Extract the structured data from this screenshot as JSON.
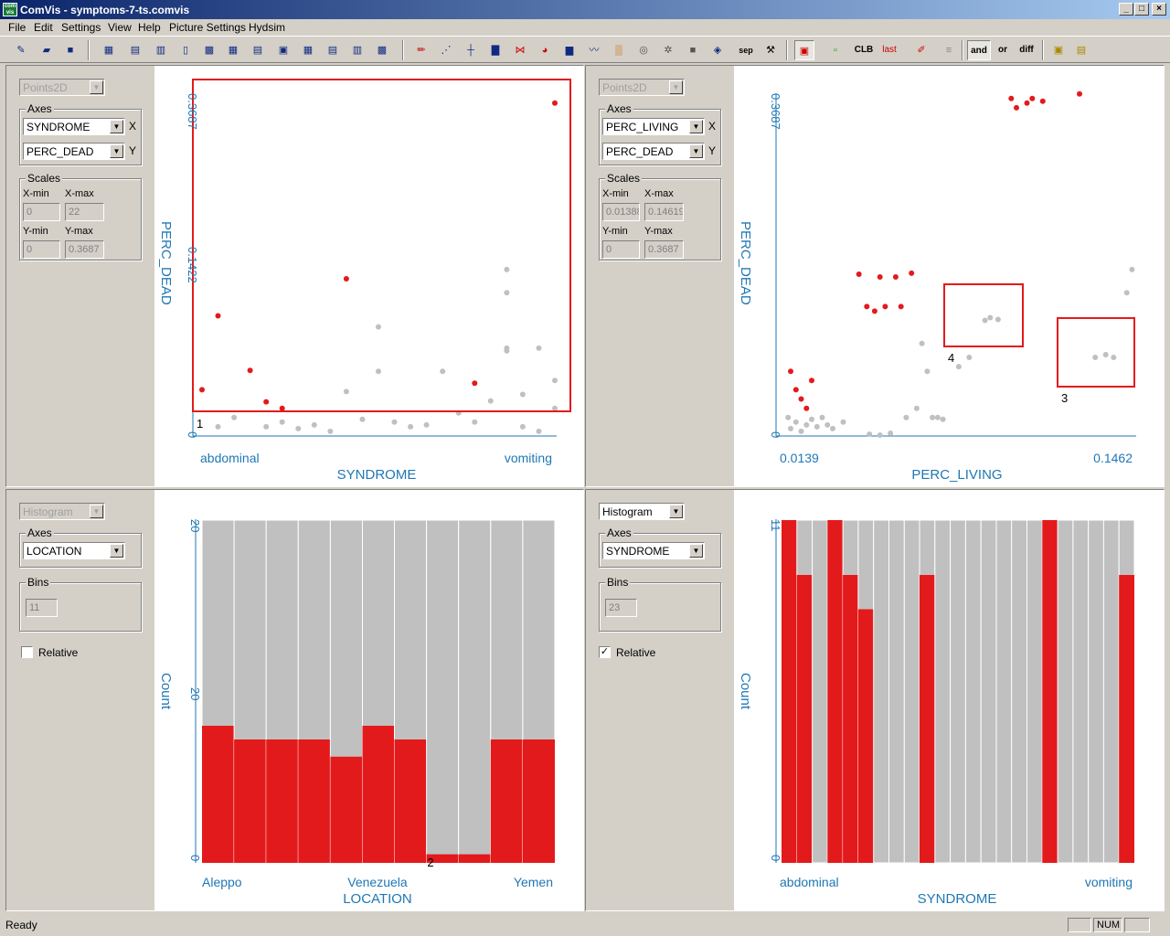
{
  "window": {
    "title": "ComVis - symptoms-7-ts.comvis",
    "icon_text": "com vis"
  },
  "menu": [
    "File",
    "Edit",
    "Settings",
    "View",
    "Help",
    "Picture Settings",
    "Hydsim"
  ],
  "toolbar": {
    "sep_label": "sep",
    "clb_label": "CLB",
    "lst_label": "last",
    "and_label": "and",
    "or_label": "or",
    "diff_label": "diff"
  },
  "colors": {
    "selected": "#e31a1c",
    "unselected": "#c0c0c0",
    "axis": "#1f77b4",
    "brush": "#e31a1c"
  },
  "views": [
    {
      "type_label": "Points2D",
      "type_enabled": false,
      "axes_label": "Axes",
      "x_axis": "SYNDROME",
      "y_axis": "PERC_DEAD",
      "x_marker": "X",
      "y_marker": "Y",
      "scales_label": "Scales",
      "xmin_label": "X-min",
      "xmax_label": "X-max",
      "ymin_label": "Y-min",
      "ymax_label": "Y-max",
      "xmin": "0",
      "xmax": "22",
      "ymin": "0",
      "ymax": "0.3687",
      "plot": {
        "xlabel": "SYNDROME",
        "ylabel": "PERC_DEAD",
        "x_first": "abdominal",
        "x_last": "vomiting",
        "y_top": "0.3687",
        "y_mid": "0.1422",
        "y_zero": "0",
        "brush_label": "1"
      }
    },
    {
      "type_label": "Points2D",
      "type_enabled": false,
      "axes_label": "Axes",
      "x_axis": "PERC_LIVING",
      "y_axis": "PERC_DEAD",
      "x_marker": "X",
      "y_marker": "Y",
      "scales_label": "Scales",
      "xmin_label": "X-min",
      "xmax_label": "X-max",
      "ymin_label": "Y-min",
      "ymax_label": "Y-max",
      "xmin": "0.01388",
      "xmax": "0.14619",
      "ymin": "0",
      "ymax": "0.3687",
      "plot": {
        "xlabel": "PERC_LIVING",
        "ylabel": "PERC_DEAD",
        "x_first": "0.0139",
        "x_last": "0.1462",
        "y_top": "0.3687",
        "y_zero": "0",
        "brush3_label": "3",
        "brush4_label": "4"
      }
    },
    {
      "type_label": "Histogram",
      "type_enabled": false,
      "axes_label": "Axes",
      "x_axis": "LOCATION",
      "bins_label": "Bins",
      "bins": "11",
      "relative_label": "Relative",
      "relative": false,
      "plot": {
        "xlabel": "LOCATION",
        "ylabel": "Count",
        "x_first": "Aleppo",
        "x_mid": "Venezuela",
        "x_last": "Yemen",
        "y_top": "20",
        "y_mid": "20",
        "y_zero": "0",
        "brush_label": "2"
      }
    },
    {
      "type_label": "Histogram",
      "type_enabled": true,
      "axes_label": "Axes",
      "x_axis": "SYNDROME",
      "bins_label": "Bins",
      "bins": "23",
      "relative_label": "Relative",
      "relative": true,
      "plot": {
        "xlabel": "SYNDROME",
        "ylabel": "Count",
        "x_first": "abdominal",
        "x_last": "vomiting",
        "y_top": "11",
        "y_zero": "0"
      }
    }
  ],
  "chart_data": [
    {
      "type": "scatter",
      "xlabel": "SYNDROME",
      "ylabel": "PERC_DEAD",
      "xlim": [
        0,
        22
      ],
      "ylim": [
        0,
        0.3687
      ],
      "series": [
        {
          "name": "selected",
          "points": [
            [
              0,
              0.05
            ],
            [
              1,
              0.13
            ],
            [
              3,
              0.071
            ],
            [
              4,
              0.037
            ],
            [
              5,
              0.03
            ],
            [
              9,
              0.17
            ],
            [
              17,
              0.057
            ],
            [
              22,
              0.36
            ]
          ]
        },
        {
          "name": "unselected",
          "points": [
            [
              1,
              0.01
            ],
            [
              2,
              0.02
            ],
            [
              4,
              0.01
            ],
            [
              5,
              0.015
            ],
            [
              6,
              0.008
            ],
            [
              7,
              0.012
            ],
            [
              8,
              0.005
            ],
            [
              9,
              0.048
            ],
            [
              10,
              0.018
            ],
            [
              11,
              0.118
            ],
            [
              11,
              0.07
            ],
            [
              12,
              0.015
            ],
            [
              13,
              0.01
            ],
            [
              14,
              0.012
            ],
            [
              15,
              0.07
            ],
            [
              16,
              0.025
            ],
            [
              17,
              0.015
            ],
            [
              18,
              0.038
            ],
            [
              19,
              0.092
            ],
            [
              19,
              0.095
            ],
            [
              19,
              0.155
            ],
            [
              19,
              0.18
            ],
            [
              20,
              0.045
            ],
            [
              20,
              0.01
            ],
            [
              21,
              0.095
            ],
            [
              21,
              0.005
            ],
            [
              22,
              0.06
            ],
            [
              22,
              0.03
            ]
          ]
        }
      ]
    },
    {
      "type": "scatter",
      "xlabel": "PERC_LIVING",
      "ylabel": "PERC_DEAD",
      "xlim": [
        0.0139,
        0.1462
      ],
      "ylim": [
        0,
        0.3687
      ],
      "series": [
        {
          "name": "selected",
          "points": [
            [
              0.016,
              0.07
            ],
            [
              0.018,
              0.05
            ],
            [
              0.02,
              0.04
            ],
            [
              0.022,
              0.03
            ],
            [
              0.024,
              0.06
            ],
            [
              0.042,
              0.175
            ],
            [
              0.045,
              0.14
            ],
            [
              0.048,
              0.135
            ],
            [
              0.05,
              0.172
            ],
            [
              0.052,
              0.14
            ],
            [
              0.056,
              0.172
            ],
            [
              0.058,
              0.14
            ],
            [
              0.062,
              0.176
            ],
            [
              0.1,
              0.365
            ],
            [
              0.102,
              0.355
            ],
            [
              0.106,
              0.36
            ],
            [
              0.108,
              0.365
            ],
            [
              0.112,
              0.362
            ],
            [
              0.126,
              0.37
            ]
          ]
        },
        {
          "name": "unselected",
          "points": [
            [
              0.015,
              0.02
            ],
            [
              0.016,
              0.008
            ],
            [
              0.018,
              0.015
            ],
            [
              0.02,
              0.005
            ],
            [
              0.022,
              0.012
            ],
            [
              0.024,
              0.018
            ],
            [
              0.026,
              0.01
            ],
            [
              0.028,
              0.02
            ],
            [
              0.03,
              0.012
            ],
            [
              0.032,
              0.008
            ],
            [
              0.036,
              0.015
            ],
            [
              0.046,
              0.002
            ],
            [
              0.05,
              0.001
            ],
            [
              0.054,
              0.003
            ],
            [
              0.06,
              0.02
            ],
            [
              0.064,
              0.03
            ],
            [
              0.066,
              0.1
            ],
            [
              0.068,
              0.07
            ],
            [
              0.07,
              0.02
            ],
            [
              0.072,
              0.02
            ],
            [
              0.074,
              0.018
            ],
            [
              0.08,
              0.075
            ],
            [
              0.084,
              0.085
            ],
            [
              0.09,
              0.125
            ],
            [
              0.092,
              0.128
            ],
            [
              0.095,
              0.126
            ],
            [
              0.132,
              0.085
            ],
            [
              0.136,
              0.088
            ],
            [
              0.139,
              0.085
            ],
            [
              0.144,
              0.155
            ],
            [
              0.146,
              0.18
            ]
          ]
        }
      ]
    },
    {
      "type": "bar",
      "xlabel": "LOCATION",
      "ylabel": "Count",
      "ylim": [
        0,
        20
      ],
      "categories": [
        "Aleppo",
        "",
        "",
        "",
        "",
        "Venezuela",
        "",
        "",
        "",
        "",
        "Yemen"
      ],
      "series": [
        {
          "name": "total",
          "values": [
            20,
            20,
            20,
            20,
            20,
            20,
            20,
            20,
            20,
            20,
            20
          ]
        },
        {
          "name": "selected",
          "values": [
            8,
            7.2,
            7.2,
            7.2,
            6.2,
            8,
            7.2,
            0.5,
            0.5,
            7.2,
            7.2
          ]
        }
      ]
    },
    {
      "type": "bar",
      "xlabel": "SYNDROME",
      "ylabel": "Count",
      "relative": true,
      "ylim": [
        0,
        11
      ],
      "categories": [
        "abdominal",
        "",
        "",
        "",
        "",
        "",
        "",
        "",
        "",
        "",
        "",
        "",
        "",
        "",
        "",
        "",
        "",
        "",
        "",
        "",
        "",
        "",
        "vomiting"
      ],
      "series": [
        {
          "name": "total",
          "values": [
            1,
            1,
            1,
            1,
            1,
            1,
            1,
            1,
            1,
            1,
            1,
            1,
            1,
            1,
            1,
            1,
            1,
            1,
            1,
            1,
            1,
            1,
            1
          ]
        },
        {
          "name": "selected",
          "values": [
            1,
            0.84,
            0,
            1,
            0.84,
            0.74,
            0,
            0,
            0,
            0.84,
            0,
            0,
            0,
            0,
            0,
            0,
            0,
            1,
            0,
            0,
            0,
            0,
            0.84
          ]
        }
      ]
    }
  ]
}
